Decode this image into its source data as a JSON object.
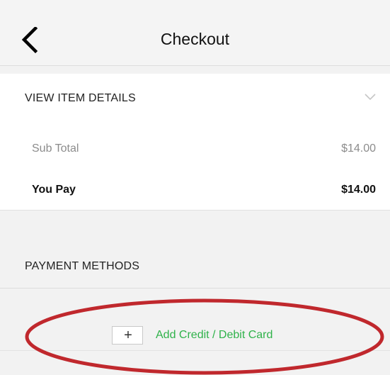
{
  "header": {
    "title": "Checkout",
    "back_icon": "chevron-left-icon"
  },
  "item_details": {
    "label": "VIEW ITEM DETAILS",
    "toggle_icon": "chevron-down-icon"
  },
  "summary": {
    "subtotal_label": "Sub Total",
    "subtotal_value": "$14.00",
    "you_pay_label": "You Pay",
    "you_pay_value": "$14.00"
  },
  "payment": {
    "header": "PAYMENT METHODS",
    "add_card_label": "Add Credit / Debit Card",
    "add_icon_glyph": "+",
    "add_icon": "plus-icon"
  },
  "colors": {
    "accent_green": "#2fb24a",
    "highlight_red": "#c0282d",
    "background": "#f2f2f2"
  }
}
